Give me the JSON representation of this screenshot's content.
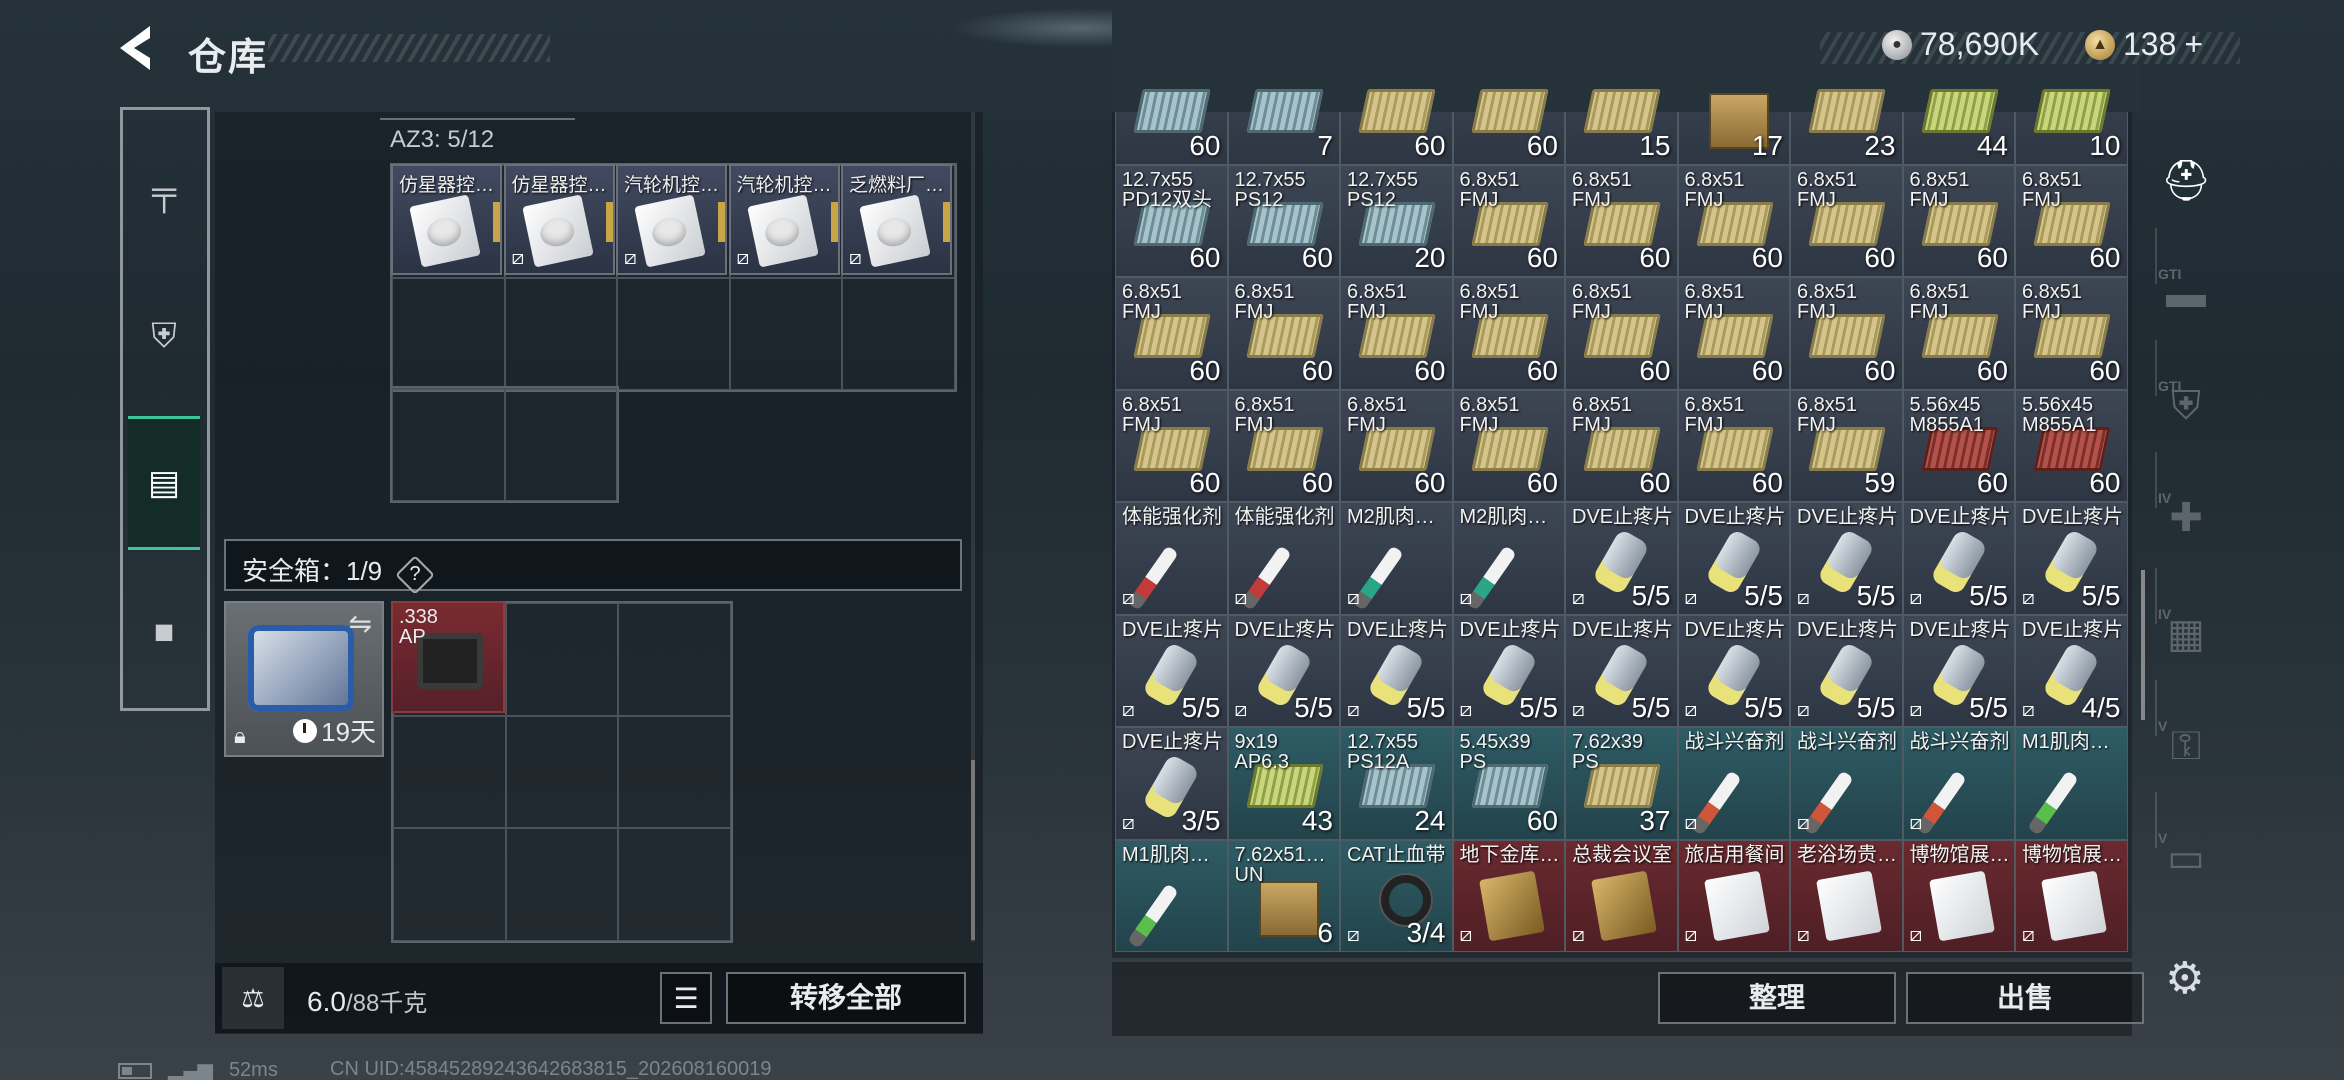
{
  "header": {
    "title": "仓库"
  },
  "currency": {
    "silver": "78,690K",
    "gold": "138",
    "gold_plus": "+"
  },
  "left_nav": [
    "gun-icon",
    "armor-icon",
    "backpack-icon",
    "briefcase-icon"
  ],
  "container": {
    "label": "AZ3: 5/12",
    "items": [
      {
        "name": "仿星器控…",
        "nobox": false
      },
      {
        "name": "仿星器控…",
        "nobox": true
      },
      {
        "name": "汽轮机控…",
        "nobox": true
      },
      {
        "name": "汽轮机控…",
        "nobox": true
      },
      {
        "name": "乏燃料厂…",
        "nobox": true
      }
    ]
  },
  "safe": {
    "label": "安全箱：1/9",
    "help": "?",
    "timer": "19天",
    "item": {
      "name": ".338\nAP"
    }
  },
  "bottom_left": {
    "weight_current": "6.0",
    "weight_max": "/88千克",
    "move_all": "转移全部"
  },
  "bottom_right": {
    "sort": "整理",
    "sell": "出售"
  },
  "status": {
    "ping": "52ms",
    "uid": "CN UID:458452892436426838​15_202608160019"
  },
  "stash": [
    {
      "n": "",
      "c": "60",
      "bg": "gray",
      "g": "ammo blue"
    },
    {
      "n": "",
      "c": "7",
      "bg": "gray",
      "g": "ammo blue"
    },
    {
      "n": "",
      "c": "60",
      "bg": "gray",
      "g": "ammo"
    },
    {
      "n": "",
      "c": "60",
      "bg": "gray",
      "g": "ammo"
    },
    {
      "n": "",
      "c": "15",
      "bg": "gray",
      "g": "ammo"
    },
    {
      "n": "",
      "c": "17",
      "bg": "gray",
      "g": "crate"
    },
    {
      "n": "",
      "c": "23",
      "bg": "gray",
      "g": "ammo"
    },
    {
      "n": "",
      "c": "44",
      "bg": "gray",
      "g": "ammo green"
    },
    {
      "n": "",
      "c": "10",
      "bg": "gray",
      "g": "ammo green"
    },
    {
      "n": "12.7x55\nPD12双头",
      "c": "60",
      "bg": "gray",
      "g": "ammo blue"
    },
    {
      "n": "12.7x55\nPS12",
      "c": "60",
      "bg": "gray",
      "g": "ammo blue"
    },
    {
      "n": "12.7x55\nPS12",
      "c": "20",
      "bg": "gray",
      "g": "ammo blue"
    },
    {
      "n": "6.8x51\nFMJ",
      "c": "60",
      "bg": "gray",
      "g": "ammo"
    },
    {
      "n": "6.8x51\nFMJ",
      "c": "60",
      "bg": "gray",
      "g": "ammo"
    },
    {
      "n": "6.8x51\nFMJ",
      "c": "60",
      "bg": "gray",
      "g": "ammo"
    },
    {
      "n": "6.8x51\nFMJ",
      "c": "60",
      "bg": "gray",
      "g": "ammo"
    },
    {
      "n": "6.8x51\nFMJ",
      "c": "60",
      "bg": "gray",
      "g": "ammo"
    },
    {
      "n": "6.8x51\nFMJ",
      "c": "60",
      "bg": "gray",
      "g": "ammo"
    },
    {
      "n": "6.8x51\nFMJ",
      "c": "60",
      "bg": "gray",
      "g": "ammo"
    },
    {
      "n": "6.8x51\nFMJ",
      "c": "60",
      "bg": "gray",
      "g": "ammo"
    },
    {
      "n": "6.8x51\nFMJ",
      "c": "60",
      "bg": "gray",
      "g": "ammo"
    },
    {
      "n": "6.8x51\nFMJ",
      "c": "60",
      "bg": "gray",
      "g": "ammo"
    },
    {
      "n": "6.8x51\nFMJ",
      "c": "60",
      "bg": "gray",
      "g": "ammo"
    },
    {
      "n": "6.8x51\nFMJ",
      "c": "60",
      "bg": "gray",
      "g": "ammo"
    },
    {
      "n": "6.8x51\nFMJ",
      "c": "60",
      "bg": "gray",
      "g": "ammo"
    },
    {
      "n": "6.8x51\nFMJ",
      "c": "60",
      "bg": "gray",
      "g": "ammo"
    },
    {
      "n": "6.8x51\nFMJ",
      "c": "60",
      "bg": "gray",
      "g": "ammo"
    },
    {
      "n": "6.8x51\nFMJ",
      "c": "60",
      "bg": "gray",
      "g": "ammo"
    },
    {
      "n": "6.8x51\nFMJ",
      "c": "60",
      "bg": "gray",
      "g": "ammo"
    },
    {
      "n": "6.8x51\nFMJ",
      "c": "60",
      "bg": "gray",
      "g": "ammo"
    },
    {
      "n": "6.8x51\nFMJ",
      "c": "60",
      "bg": "gray",
      "g": "ammo"
    },
    {
      "n": "6.8x51\nFMJ",
      "c": "60",
      "bg": "gray",
      "g": "ammo"
    },
    {
      "n": "6.8x51\nFMJ",
      "c": "60",
      "bg": "gray",
      "g": "ammo"
    },
    {
      "n": "6.8x51\nFMJ",
      "c": "59",
      "bg": "gray",
      "g": "ammo"
    },
    {
      "n": "5.56x45\nM855A1",
      "c": "60",
      "bg": "gray",
      "g": "ammo red"
    },
    {
      "n": "5.56x45\nM855A1",
      "c": "60",
      "bg": "gray",
      "g": "ammo red"
    },
    {
      "n": "体能强化剂",
      "c": "",
      "bg": "gray",
      "g": "inj red",
      "nb": true
    },
    {
      "n": "体能强化剂",
      "c": "",
      "bg": "gray",
      "g": "inj red",
      "nb": true
    },
    {
      "n": "M2肌肉…",
      "c": "",
      "bg": "gray",
      "g": "inj teal",
      "nb": true
    },
    {
      "n": "M2肌肉…",
      "c": "",
      "bg": "gray",
      "g": "inj teal",
      "nb": true
    },
    {
      "n": "DVE止疼片",
      "c": "5/5",
      "bg": "gray",
      "g": "pill",
      "nb": true
    },
    {
      "n": "DVE止疼片",
      "c": "5/5",
      "bg": "gray",
      "g": "pill",
      "nb": true
    },
    {
      "n": "DVE止疼片",
      "c": "5/5",
      "bg": "gray",
      "g": "pill",
      "nb": true
    },
    {
      "n": "DVE止疼片",
      "c": "5/5",
      "bg": "gray",
      "g": "pill",
      "nb": true
    },
    {
      "n": "DVE止疼片",
      "c": "5/5",
      "bg": "gray",
      "g": "pill",
      "nb": true
    },
    {
      "n": "DVE止疼片",
      "c": "5/5",
      "bg": "gray",
      "g": "pill",
      "nb": true
    },
    {
      "n": "DVE止疼片",
      "c": "5/5",
      "bg": "gray",
      "g": "pill",
      "nb": true
    },
    {
      "n": "DVE止疼片",
      "c": "5/5",
      "bg": "gray",
      "g": "pill",
      "nb": true
    },
    {
      "n": "DVE止疼片",
      "c": "5/5",
      "bg": "gray",
      "g": "pill",
      "nb": true
    },
    {
      "n": "DVE止疼片",
      "c": "5/5",
      "bg": "gray",
      "g": "pill",
      "nb": true
    },
    {
      "n": "DVE止疼片",
      "c": "5/5",
      "bg": "gray",
      "g": "pill",
      "nb": true
    },
    {
      "n": "DVE止疼片",
      "c": "5/5",
      "bg": "gray",
      "g": "pill",
      "nb": true
    },
    {
      "n": "DVE止疼片",
      "c": "5/5",
      "bg": "gray",
      "g": "pill",
      "nb": true
    },
    {
      "n": "DVE止疼片",
      "c": "4/5",
      "bg": "gray",
      "g": "pill",
      "nb": true
    },
    {
      "n": "DVE止疼片",
      "c": "3/5",
      "bg": "gray",
      "g": "pill",
      "nb": true
    },
    {
      "n": "9x19\nAP6.3",
      "c": "43",
      "bg": "teal",
      "g": "ammo green"
    },
    {
      "n": "12.7x55\nPS12A",
      "c": "24",
      "bg": "teal",
      "g": "ammo blue"
    },
    {
      "n": "5.45x39\nPS",
      "c": "60",
      "bg": "teal",
      "g": "ammo blue"
    },
    {
      "n": "7.62x39\nPS",
      "c": "37",
      "bg": "teal",
      "g": "ammo"
    },
    {
      "n": "战斗兴奋剂",
      "c": "",
      "bg": "teal",
      "g": "inj orange",
      "nb": true
    },
    {
      "n": "战斗兴奋剂",
      "c": "",
      "bg": "teal",
      "g": "inj orange",
      "nb": true
    },
    {
      "n": "战斗兴奋剂",
      "c": "",
      "bg": "teal",
      "g": "inj orange",
      "nb": true
    },
    {
      "n": "M1肌肉…",
      "c": "",
      "bg": "teal",
      "g": "inj green"
    },
    {
      "n": "M1肌肉…",
      "c": "",
      "bg": "teal",
      "g": "inj green"
    },
    {
      "n": "7.62x51…\nUN",
      "c": "6",
      "bg": "teal",
      "g": "crate"
    },
    {
      "n": "CAT止血带",
      "c": "3/4",
      "bg": "teal",
      "g": "bandage",
      "nb": true
    },
    {
      "n": "地下金库…",
      "c": "",
      "bg": "red",
      "g": "keyg",
      "nb": true
    },
    {
      "n": "总裁会议室",
      "c": "",
      "bg": "red",
      "g": "keyg",
      "nb": true
    },
    {
      "n": "旅店用餐间",
      "c": "",
      "bg": "red",
      "g": "keyc",
      "nb": true
    },
    {
      "n": "老浴场贵…",
      "c": "",
      "bg": "red",
      "g": "keyc",
      "nb": true
    },
    {
      "n": "博物馆展…",
      "c": "",
      "bg": "red",
      "g": "keyc",
      "nb": true
    },
    {
      "n": "博物馆展…",
      "c": "",
      "bg": "red",
      "g": "keyc",
      "nb": true
    }
  ],
  "right_nav": [
    {
      "icon": "helmet-icon",
      "label": ""
    },
    {
      "icon": "gun-tier-icon",
      "label": "GTI"
    },
    {
      "icon": "armor-tier-icon",
      "label": "GTI"
    },
    {
      "icon": "medical-tier-icon",
      "label": "IV"
    },
    {
      "icon": "container-tier-icon",
      "label": "IV"
    },
    {
      "icon": "key-tier-icon",
      "label": "V"
    },
    {
      "icon": "keycard-tier-icon",
      "label": "V"
    }
  ]
}
